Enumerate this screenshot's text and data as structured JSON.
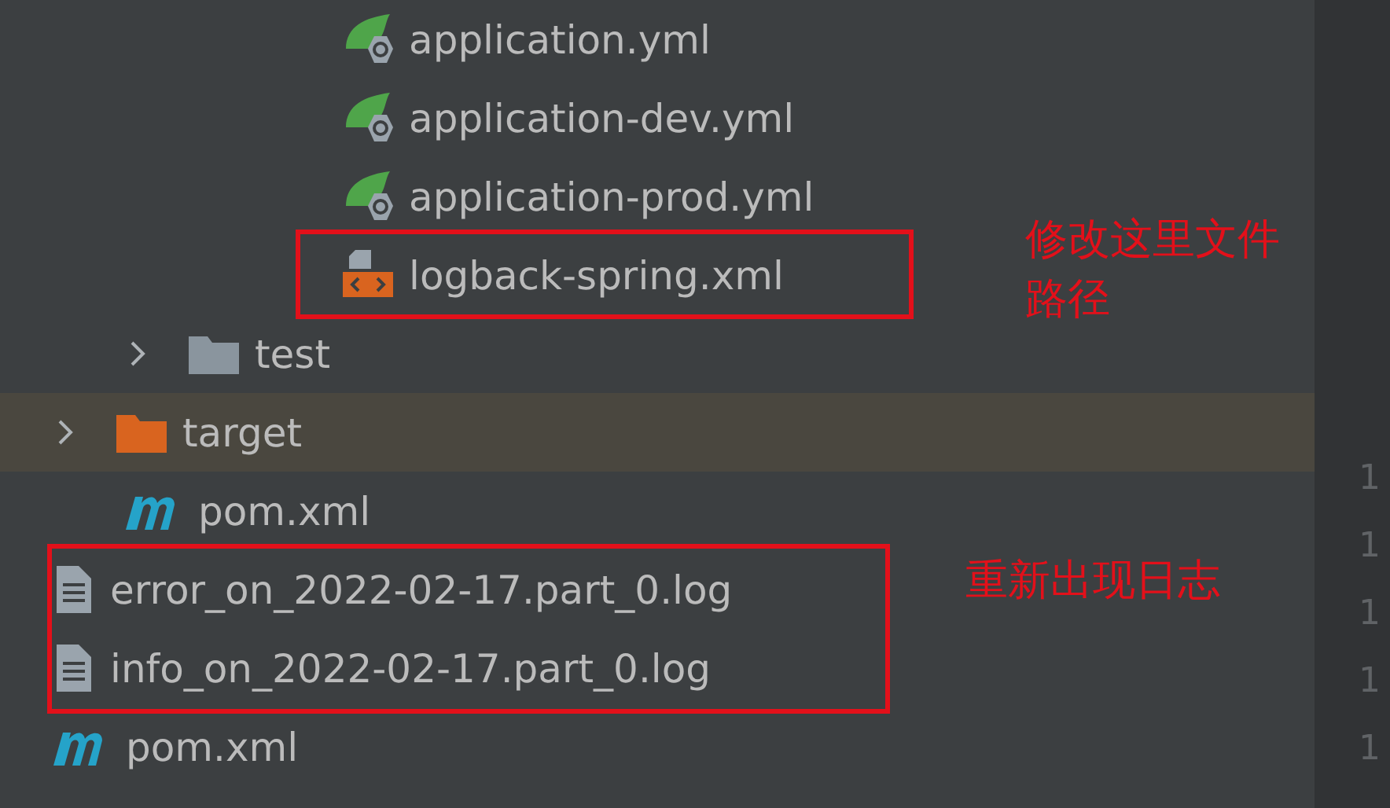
{
  "tree": [
    {
      "children": [
        {
          "children": [
            {
              "children": [
                {
                  "children": [
                    {
                      "kind": "spring",
                      "label": "application.yml",
                      "selected": false
                    },
                    {
                      "kind": "spring",
                      "label": "application-dev.yml",
                      "selected": false
                    },
                    {
                      "kind": "spring",
                      "label": "application-prod.yml",
                      "selected": false
                    },
                    {
                      "kind": "xml",
                      "label": "logback-spring.xml",
                      "selected": false
                    }
                  ]
                }
              ]
            }
          ]
        },
        {
          "kind": "folder",
          "label": "test",
          "expanded": false,
          "selected": false
        }
      ]
    },
    {
      "kind": "excluded-folder",
      "label": "target",
      "expanded": false,
      "selected": true
    },
    {
      "children": [
        {
          "kind": "maven",
          "label": "pom.xml",
          "selected": false
        }
      ]
    },
    {
      "kind": "text",
      "label": "error_on_2022-02-17.part_0.log",
      "selected": false
    },
    {
      "kind": "text",
      "label": "info_on_2022-02-17.part_0.log",
      "selected": false
    },
    {
      "kind": "maven",
      "label": "pom.xml",
      "selected": false
    }
  ],
  "annotations": [
    {
      "kind": "config",
      "text": "修改这里文件路径"
    },
    {
      "kind": "logs",
      "text": "重新出现日志"
    }
  ],
  "gutter": [
    "1",
    "1",
    "1",
    "1",
    "1"
  ]
}
